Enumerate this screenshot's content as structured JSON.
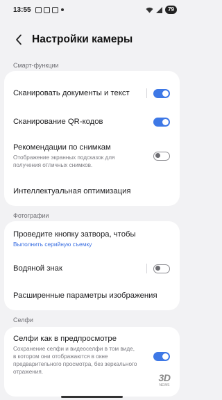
{
  "status": {
    "time": "13:55",
    "battery": "79"
  },
  "header": {
    "title": "Настройки камеры"
  },
  "sections": {
    "smart": "Смарт-функции",
    "photos": "Фотографии",
    "selfie": "Селфи"
  },
  "smart": {
    "scan_docs": "Сканировать документы и текст",
    "scan_qr": "Сканирование QR-кодов",
    "shot_suggest": "Рекомендации по снимкам",
    "shot_suggest_sub": "Отображение экранных подсказок для получения отличных снимков.",
    "intelligent": "Интеллектуальная оптимизация"
  },
  "photos": {
    "swipe_shutter": "Проведите кнопку затвора, чтобы",
    "swipe_shutter_sub": "Выполнить серийную съемку",
    "watermark": "Водяной знак",
    "advanced": "Расширенные параметры изображения"
  },
  "selfie": {
    "as_preview": "Селфи как в предпросмотре",
    "as_preview_sub": "Сохранение селфи и видеоселфи в том виде, в котором они отображаются в окне предварительного просмотра, без зеркального отражения."
  },
  "toggles": {
    "scan_docs": true,
    "scan_qr": true,
    "shot_suggest": false,
    "watermark": false,
    "as_preview": true
  },
  "brand": {
    "logo": "3D",
    "tagline": "NEWS"
  },
  "colors": {
    "accent": "#3e78e6",
    "background": "#f2f2f4"
  }
}
